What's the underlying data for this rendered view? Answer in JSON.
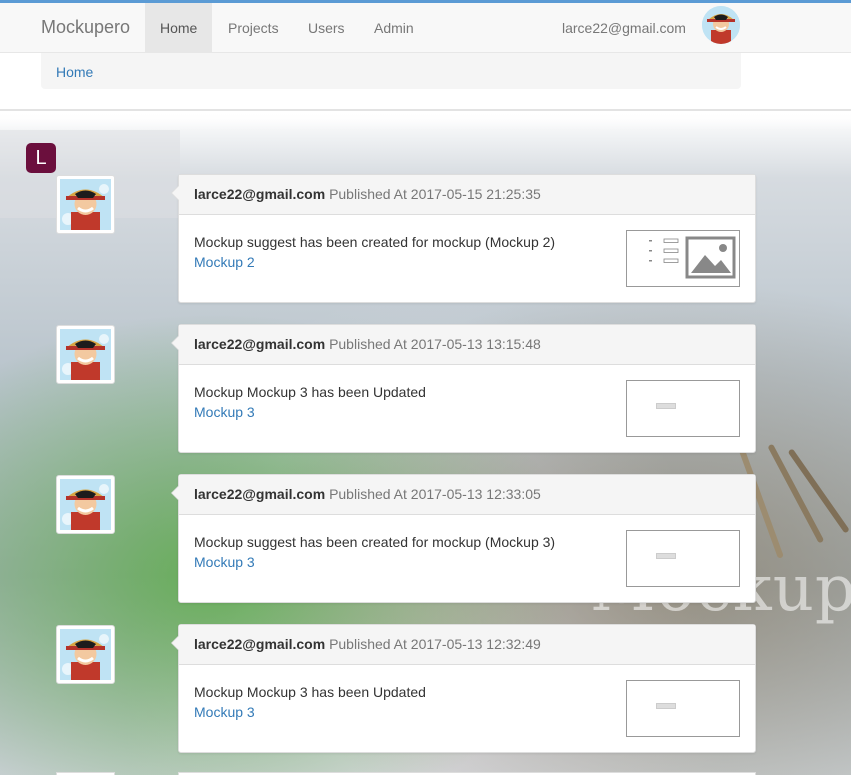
{
  "navbar": {
    "brand": "Mockupero",
    "items": [
      {
        "label": "Home",
        "active": true
      },
      {
        "label": "Projects",
        "active": false
      },
      {
        "label": "Users",
        "active": false
      },
      {
        "label": "Admin",
        "active": false
      }
    ],
    "user_email": "larce22@gmail.com",
    "avatar_icon": "user-avatar-icon"
  },
  "breadcrumb": {
    "items": [
      "Home"
    ]
  },
  "badge": {
    "letter": "L",
    "color": "#6b0f3d"
  },
  "background": {
    "watermark": "Mockup"
  },
  "timeline": [
    {
      "author": "larce22@gmail.com",
      "published": "Published At 2017-05-15 21:25:35",
      "message": "Mockup suggest has been created for mockup (Mockup 2)",
      "link": "Mockup 2",
      "thumbnail": "image-placeholder-thumbnail"
    },
    {
      "author": "larce22@gmail.com",
      "published": "Published At 2017-05-13 13:15:48",
      "message": "Mockup Mockup 3 has been Updated",
      "link": "Mockup 3",
      "thumbnail": "button-thumbnail"
    },
    {
      "author": "larce22@gmail.com",
      "published": "Published At 2017-05-13 12:33:05",
      "message": "Mockup suggest has been created for mockup (Mockup 3)",
      "link": "Mockup 3",
      "thumbnail": "button-thumbnail"
    },
    {
      "author": "larce22@gmail.com",
      "published": "Published At 2017-05-13 12:32:49",
      "message": "Mockup Mockup 3 has been Updated",
      "link": "Mockup 3",
      "thumbnail": "button-thumbnail"
    }
  ],
  "colors": {
    "link": "#337ab7",
    "accent_line": "#5b9bd5"
  }
}
